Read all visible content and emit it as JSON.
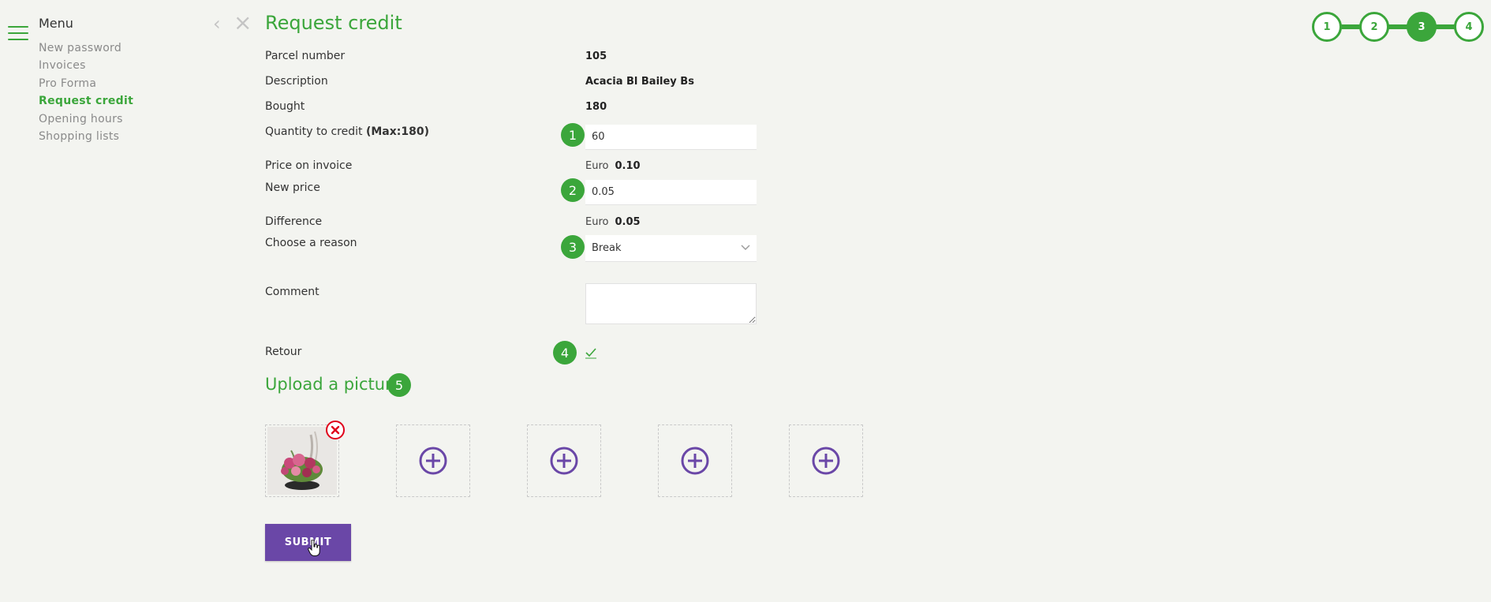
{
  "menu": {
    "title": "Menu",
    "items": [
      {
        "label": "New password"
      },
      {
        "label": "Invoices"
      },
      {
        "label": "Pro Forma"
      },
      {
        "label": "Request credit",
        "active": true
      },
      {
        "label": "Opening hours"
      },
      {
        "label": "Shopping lists"
      }
    ]
  },
  "page": {
    "title": "Request credit"
  },
  "stepper": {
    "steps": [
      "1",
      "2",
      "3",
      "4"
    ],
    "current": "3"
  },
  "form": {
    "parcel_number": {
      "label": "Parcel number",
      "value": "105"
    },
    "description": {
      "label": "Description",
      "value": "Acacia Bl Bailey Bs"
    },
    "bought": {
      "label": "Bought",
      "value": "180"
    },
    "quantity": {
      "label": "Quantity to credit",
      "max_label": "(Max:180)",
      "value": "60",
      "badge": "1"
    },
    "price_on_invoice": {
      "label": "Price on invoice",
      "currency": "Euro",
      "value": "0.10"
    },
    "new_price": {
      "label": "New price",
      "value": "0.05",
      "badge": "2"
    },
    "difference": {
      "label": "Difference",
      "currency": "Euro",
      "value": "0.05"
    },
    "reason": {
      "label": "Choose a reason",
      "value": "Break",
      "badge": "3"
    },
    "comment": {
      "label": "Comment",
      "value": ""
    },
    "retour": {
      "label": "Retour",
      "checked": true,
      "badge": "4"
    }
  },
  "upload": {
    "title": "Upload a picture",
    "badge": "5",
    "slots": [
      {
        "filled": true,
        "image": "flower-arrangement"
      },
      {
        "filled": false
      },
      {
        "filled": false
      },
      {
        "filled": false
      },
      {
        "filled": false
      }
    ]
  },
  "submit_label": "SUBMIT",
  "colors": {
    "accent_green": "#3ba63b",
    "brand_purple": "#6a47a7",
    "remove_red": "#e0001a"
  }
}
